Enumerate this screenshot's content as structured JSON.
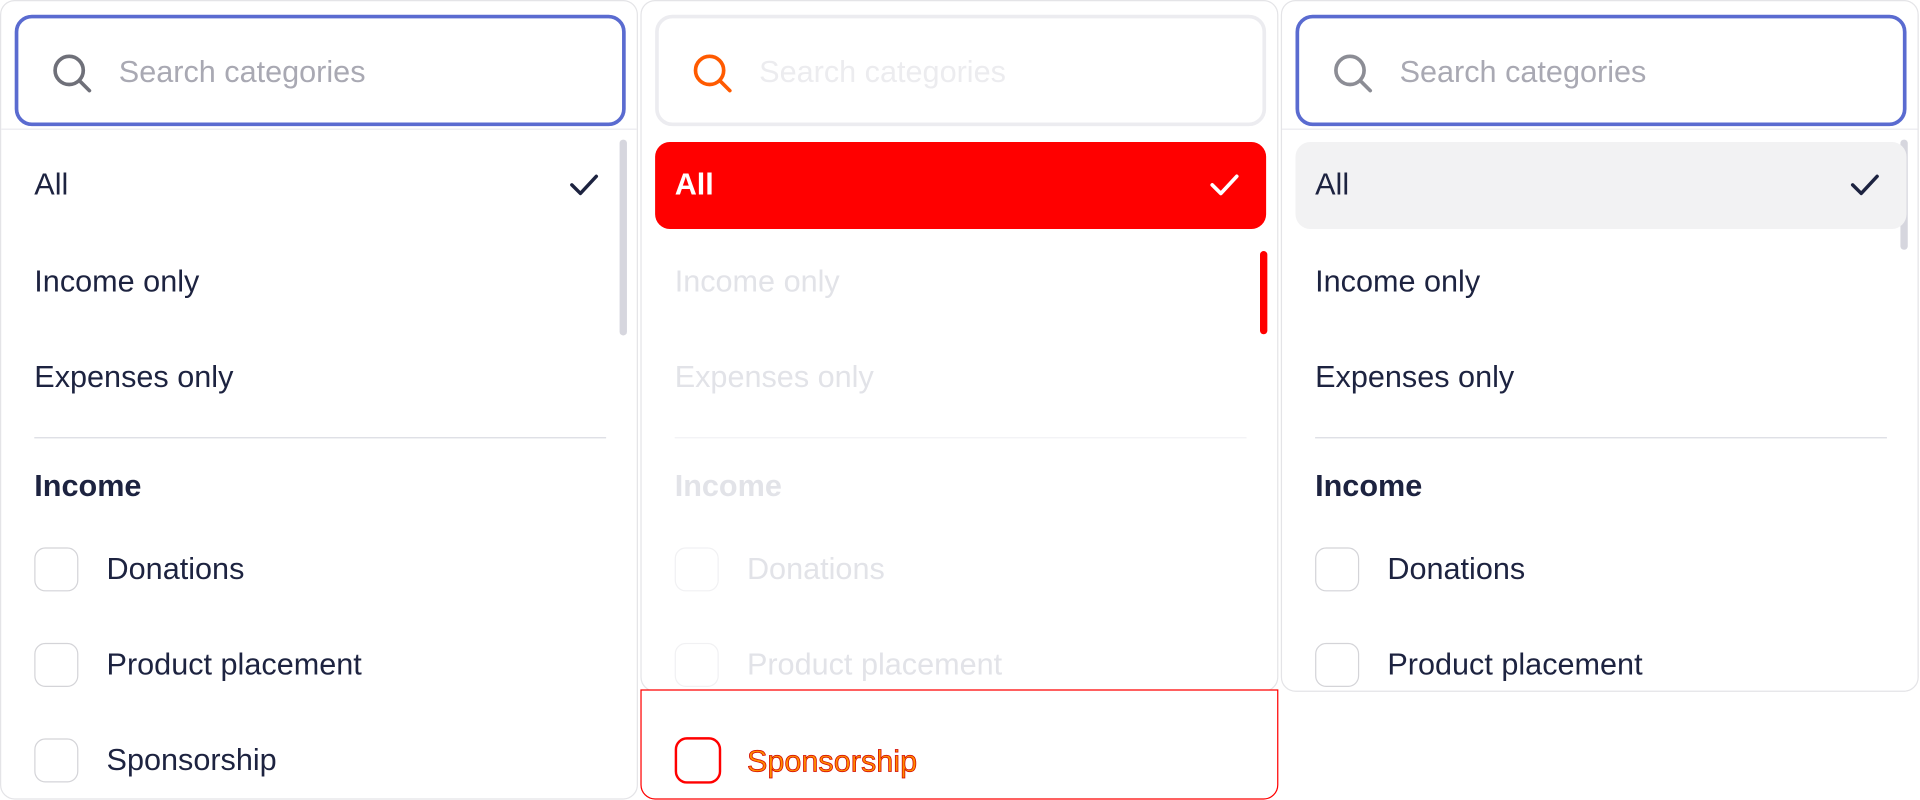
{
  "panels": [
    {
      "search_placeholder": "Search categories",
      "options": [
        "All",
        "Income only",
        "Expenses only"
      ],
      "group_title": "Income",
      "categories": [
        "Donations",
        "Product placement",
        "Sponsorship"
      ]
    },
    {
      "search_placeholder": "Search categories",
      "options": [
        "All",
        "Income only",
        "Expenses only"
      ],
      "group_title": "Income",
      "categories": [
        "Donations",
        "Product placement",
        "Sponsorship"
      ]
    },
    {
      "search_placeholder": "Search categories",
      "options": [
        "All",
        "Income only",
        "Expenses only"
      ],
      "group_title": "Income",
      "categories": [
        "Donations",
        "Product placement"
      ]
    }
  ],
  "selected_option": "All",
  "colors": {
    "focus_border": "#5a6bd0",
    "text": "#1d2340",
    "placeholder": "#a9a9b3",
    "highlight": "#ff0000",
    "selected_bg": "#f2f2f3"
  },
  "icons": [
    "search-icon",
    "checkmark-icon",
    "checkbox-icon"
  ]
}
